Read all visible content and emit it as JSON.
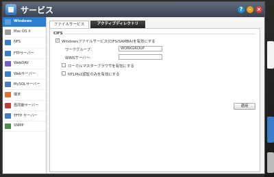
{
  "window": {
    "title": "サービス",
    "help": "?",
    "minimize": "–",
    "close": "×"
  },
  "sidebar": {
    "items": [
      {
        "label": "Windows",
        "icon": "windows-icon",
        "color": "#5aa0e0"
      },
      {
        "label": "Mac OS X",
        "icon": "mac-icon",
        "color": "#9a9a9a"
      },
      {
        "label": "NFS",
        "icon": "nfs-icon",
        "color": "#3b7dc9"
      },
      {
        "label": "FTPサーバー",
        "icon": "ftp-icon",
        "color": "#3b7dc9"
      },
      {
        "label": "WebDAV",
        "icon": "webdav-icon",
        "color": "#7a5bc0"
      },
      {
        "label": "Webサーバー",
        "icon": "web-server-icon",
        "color": "#3b7dc9"
      },
      {
        "label": "MySQLサーバー",
        "icon": "mysql-icon",
        "color": "#4a7ab8"
      },
      {
        "label": "端末",
        "icon": "terminal-icon",
        "color": "#e07030"
      },
      {
        "label": "再同期サーバー",
        "icon": "rsync-icon",
        "color": "#c03a3a"
      },
      {
        "label": "TFTP サーバー",
        "icon": "tftp-icon",
        "color": "#3b7dc9"
      },
      {
        "label": "SNMP",
        "icon": "snmp-icon",
        "color": "#4a8a4a"
      }
    ]
  },
  "tabs": {
    "file_service": "ファイルサービス",
    "active_directory": "アクティブディレクトリ"
  },
  "cifs": {
    "section": "CIFS",
    "enable_label": "Windowsファイルサービス(CIFS/SAMBA)を有効にする",
    "enable_checked": true,
    "workgroup_label": "ワークグループ:",
    "workgroup_value": "WORKGROUP",
    "wins_label": "WINSサーバー:",
    "wins_value": "",
    "local_master_label": "ローカルマスターブラウザを有効にする",
    "local_master_checked": false,
    "ntlm_label": "NTLMv2認証のみを有効にする",
    "ntlm_checked": false
  },
  "apply_label": "適用",
  "colors": {
    "accent": "#2a7fd0",
    "titlebar": "#4a5464",
    "help": "#2a8fd0",
    "minimize": "#e8a020",
    "close": "#d04040"
  }
}
